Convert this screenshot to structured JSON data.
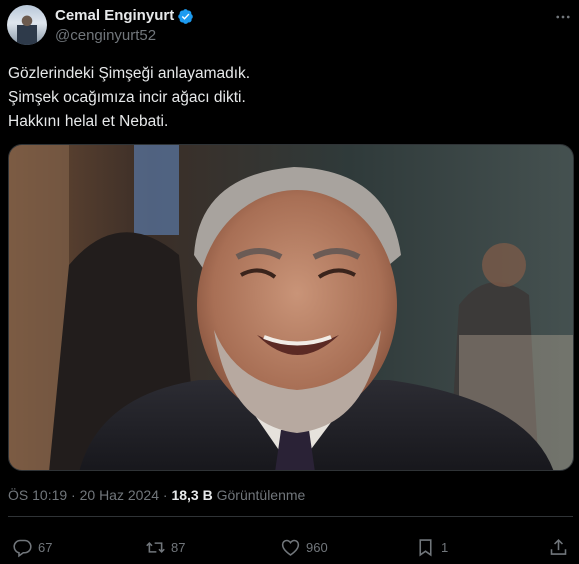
{
  "author": {
    "name": "Cemal Enginyurt",
    "handle": "@cenginyurt52",
    "verified": true,
    "verified_color": "#1d9bf0"
  },
  "tweet": {
    "lines": [
      "Gözlerindeki Şimşeği anlayamadık.",
      "Şimşek ocağımıza incir ağacı dikti.",
      "Hakkını helal et Nebati."
    ]
  },
  "meta": {
    "time": "ÖS 10:19",
    "separator": "·",
    "date": "20 Haz 2024",
    "views_count": "18,3 B",
    "views_label": "Görüntülenme"
  },
  "actions": {
    "replies": "67",
    "reposts": "87",
    "likes": "960",
    "bookmarks": "1"
  },
  "icons": {
    "more": "more-dots-icon",
    "reply": "reply-icon",
    "repost": "repost-icon",
    "like": "heart-icon",
    "bookmark": "bookmark-icon",
    "share": "share-icon"
  },
  "colors": {
    "background": "#000000",
    "text": "#e7e9ea",
    "secondary_text": "#71767b",
    "divider": "#2f3336",
    "accent": "#1d9bf0"
  }
}
